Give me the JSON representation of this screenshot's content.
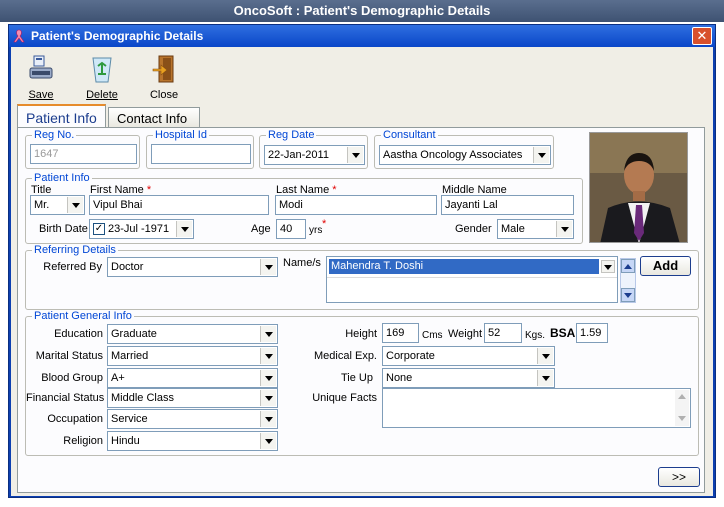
{
  "app_title": "OncoSoft : Patient's Demographic Details",
  "window_title": "Patient's Demographic Details",
  "toolbar": {
    "save": "Save",
    "delete": "Delete",
    "close": "Close"
  },
  "tabs": {
    "patient_info": "Patient Info",
    "contact_info": "Contact Info"
  },
  "reg": {
    "reg_no_label": "Reg No.",
    "reg_no_value": "1647",
    "hospital_id_label": "Hospital Id",
    "hospital_id_value": "",
    "reg_date_label": "Reg Date",
    "reg_date_value": "22-Jan-2011",
    "consultant_label": "Consultant",
    "consultant_value": "Aastha Oncology Associates"
  },
  "patient_info": {
    "group_label": "Patient Info",
    "title_label": "Title",
    "title_value": "Mr.",
    "first_name_label": "First Name",
    "first_name_value": "Vipul Bhai",
    "last_name_label": "Last Name",
    "last_name_value": "Modi",
    "middle_name_label": "Middle Name",
    "middle_name_value": "Jayanti Lal",
    "birth_date_label": "Birth Date",
    "birth_date_value": "23-Jul -1971",
    "age_label": "Age",
    "age_value": "40",
    "age_unit": "yrs",
    "gender_label": "Gender",
    "gender_value": "Male",
    "required_mark": "*",
    "check_mark": "✓"
  },
  "referring": {
    "group_label": "Referring Details",
    "referred_by_label": "Referred By",
    "referred_by_value": "Doctor",
    "names_label": "Name/s",
    "names_value": "Mahendra T. Doshi",
    "add_button": "Add"
  },
  "general": {
    "group_label": "Patient General Info",
    "education_label": "Education",
    "education_value": "Graduate",
    "marital_label": "Marital Status",
    "marital_value": "Married",
    "blood_label": "Blood Group",
    "blood_value": "A+",
    "financial_label": "Financial Status",
    "financial_value": "Middle Class",
    "occupation_label": "Occupation",
    "occupation_value": "Service",
    "religion_label": "Religion",
    "religion_value": "Hindu",
    "height_label": "Height",
    "height_value": "169",
    "height_unit": "Cms",
    "weight_label": "Weight",
    "weight_value": "52",
    "weight_unit": "Kgs.",
    "bsa_label": "BSA",
    "bsa_value": "1.59",
    "medical_label": "Medical Exp.",
    "medical_value": "Corporate",
    "tieup_label": "Tie Up",
    "tieup_value": "None",
    "unique_label": "Unique Facts",
    "unique_value": ""
  },
  "next_button": ">>",
  "colors": {
    "title_blue": "#0a46c8",
    "group_label": "#0046d5",
    "selected": "#316ac5",
    "tab_accent": "#e68b2c"
  }
}
